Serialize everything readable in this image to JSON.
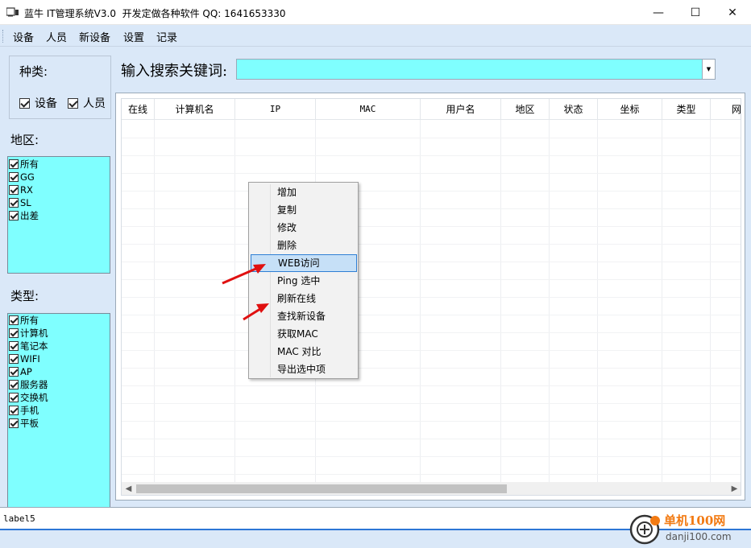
{
  "window": {
    "title": "蓝牛 IT管理系统V3.0  开发定做各种软件 QQ: 1641653330",
    "minimize_glyph": "—",
    "maximize_glyph": "☐",
    "close_glyph": "✕"
  },
  "menu": [
    "设备",
    "人员",
    "新设备",
    "设置",
    "记录"
  ],
  "kind": {
    "label": "种类:",
    "options": [
      {
        "label": "设备",
        "checked": true
      },
      {
        "label": "人员",
        "checked": true
      }
    ]
  },
  "region": {
    "label": "地区:",
    "items": [
      "所有",
      "GG",
      "RX",
      "SL",
      "出差"
    ]
  },
  "type": {
    "label": "类型:",
    "items": [
      "所有",
      "计算机",
      "笔记本",
      "WIFI",
      "AP",
      "服务器",
      "交换机",
      "手机",
      "平板"
    ]
  },
  "search": {
    "label": "输入搜索关键词:",
    "value": ""
  },
  "grid": {
    "columns": [
      "在线",
      "计算机名",
      "IP",
      "MAC",
      "用户名",
      "地区",
      "状态",
      "坐标",
      "类型",
      "网"
    ]
  },
  "context_menu": {
    "items": [
      "增加",
      "复制",
      "修改",
      "删除",
      "WEB访问",
      "Ping 选中",
      "刷新在线",
      "查找新设备",
      "获取MAC",
      "MAC 对比",
      "导出选中项"
    ],
    "highlighted": "WEB访问"
  },
  "status": {
    "text": "label5"
  },
  "watermark": {
    "line1": "单机100网",
    "line2": "danji100.com"
  },
  "colors": {
    "accent_cyan": "#7fffff",
    "panel_bg": "#dae8f8",
    "highlight": "#c6e0f7",
    "arrow_red": "#e01010"
  }
}
